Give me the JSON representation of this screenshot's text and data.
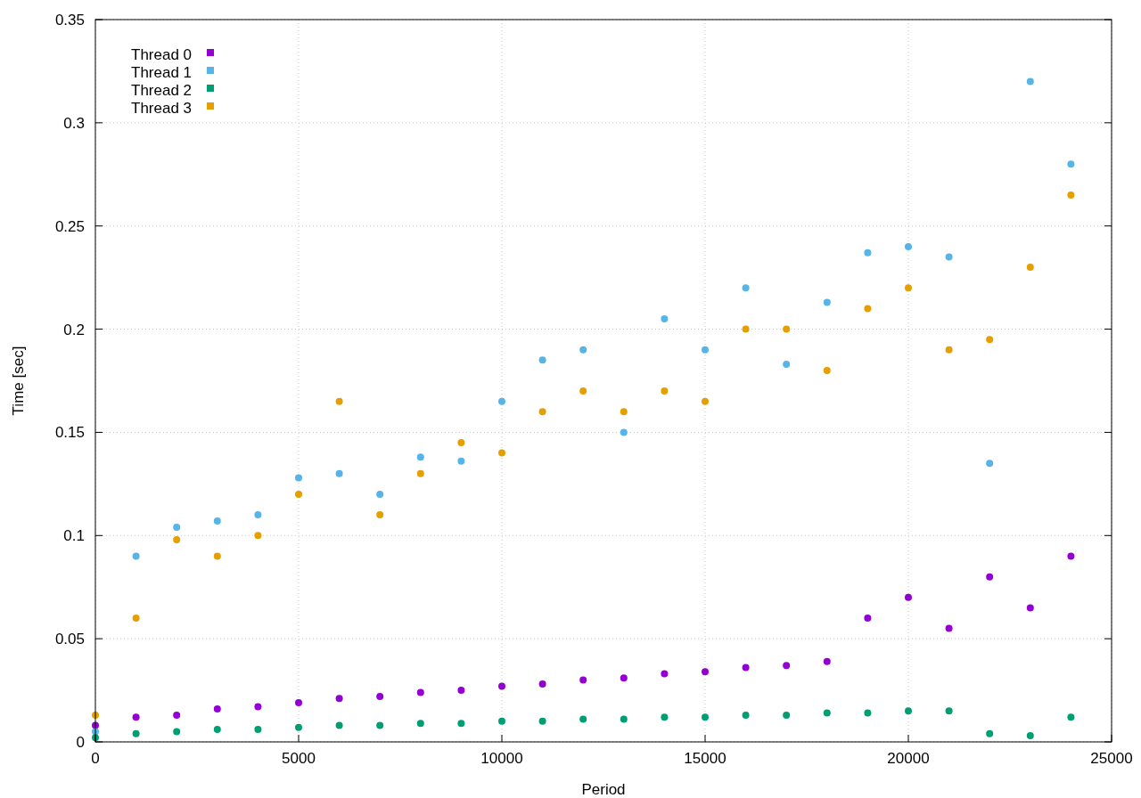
{
  "chart_data": {
    "type": "scatter",
    "xlabel": "Period",
    "ylabel": "Time [sec]",
    "xlim": [
      0,
      25000
    ],
    "ylim": [
      0,
      0.35
    ],
    "grid": true,
    "legend": "upper left",
    "x": [
      0,
      1000,
      2000,
      3000,
      4000,
      5000,
      6000,
      7000,
      8000,
      9000,
      10000,
      11000,
      12000,
      13000,
      14000,
      15000,
      16000,
      17000,
      18000,
      19000,
      20000,
      21000,
      22000,
      23000,
      24000
    ],
    "xticks": [
      0,
      5000,
      10000,
      15000,
      20000,
      25000
    ],
    "yticks": [
      {
        "value": 0,
        "label": "0"
      },
      {
        "value": 0.05,
        "label": "0.05"
      },
      {
        "value": 0.1,
        "label": "0.1"
      },
      {
        "value": 0.15,
        "label": "0.15"
      },
      {
        "value": 0.2,
        "label": "0.2"
      },
      {
        "value": 0.25,
        "label": "0.25"
      },
      {
        "value": 0.3,
        "label": "0.3"
      },
      {
        "value": 0.35,
        "label": "0.35"
      }
    ],
    "series": [
      {
        "name": "Thread 0",
        "color": "#9400d3",
        "values": [
          0.008,
          0.012,
          0.013,
          0.016,
          0.017,
          0.019,
          0.021,
          0.022,
          0.024,
          0.025,
          0.027,
          0.028,
          0.03,
          0.031,
          0.033,
          0.034,
          0.036,
          0.037,
          0.039,
          0.06,
          0.07,
          0.055,
          0.08,
          0.065,
          0.09
        ]
      },
      {
        "name": "Thread 1",
        "color": "#56b4e9",
        "values": [
          0.005,
          0.09,
          0.104,
          0.107,
          0.11,
          0.128,
          0.13,
          0.12,
          0.138,
          0.136,
          0.165,
          0.185,
          0.19,
          0.15,
          0.205,
          0.19,
          0.22,
          0.183,
          0.213,
          0.237,
          0.24,
          0.235,
          0.135,
          0.32,
          0.28
        ]
      },
      {
        "name": "Thread 2",
        "color": "#009e73",
        "values": [
          0.002,
          0.004,
          0.005,
          0.006,
          0.006,
          0.007,
          0.008,
          0.008,
          0.009,
          0.009,
          0.01,
          0.01,
          0.011,
          0.011,
          0.012,
          0.012,
          0.013,
          0.013,
          0.014,
          0.014,
          0.015,
          0.015,
          0.004,
          0.003,
          0.012
        ]
      },
      {
        "name": "Thread 3",
        "color": "#e69f00",
        "values": [
          0.013,
          0.06,
          0.098,
          0.09,
          0.1,
          0.12,
          0.165,
          0.11,
          0.13,
          0.145,
          0.14,
          0.16,
          0.17,
          0.16,
          0.17,
          0.165,
          0.2,
          0.2,
          0.18,
          0.21,
          0.22,
          0.19,
          0.195,
          0.23,
          0.265
        ]
      }
    ]
  }
}
